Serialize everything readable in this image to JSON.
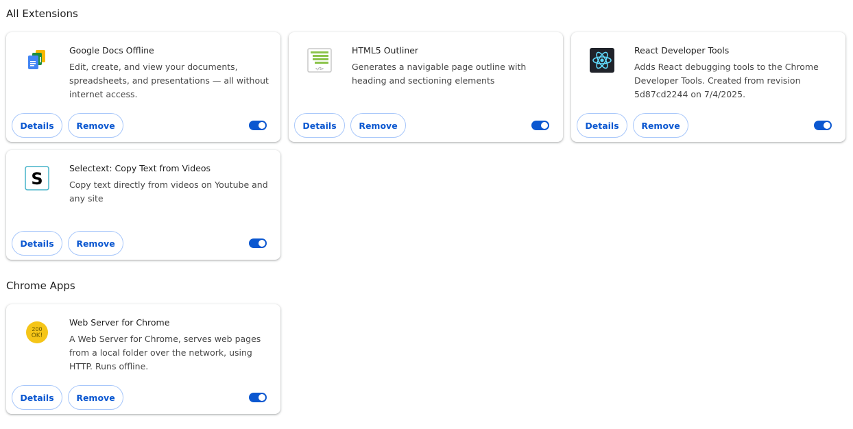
{
  "sections": {
    "extensions_title": "All Extensions",
    "apps_title": "Chrome Apps"
  },
  "extensions": [
    {
      "name": "Google Docs Offline",
      "description": "Edit, create, and view your documents, spreadsheets, and presentations — all without internet access.",
      "details_label": "Details",
      "remove_label": "Remove",
      "enabled": true,
      "icon": "google-docs-offline-icon"
    },
    {
      "name": "HTML5 Outliner",
      "description": "Generates a navigable page outline with heading and sectioning elements",
      "details_label": "Details",
      "remove_label": "Remove",
      "enabled": true,
      "icon": "html5-outliner-icon",
      "icon_text": "</5>"
    },
    {
      "name": "React Developer Tools",
      "description": "Adds React debugging tools to the Chrome Developer Tools. Created from revision 5d87cd2244 on 7/4/2025.",
      "details_label": "Details",
      "remove_label": "Remove",
      "enabled": true,
      "icon": "react-icon"
    },
    {
      "name": "Selectext: Copy Text from Videos",
      "description": "Copy text directly from videos on Youtube and any site",
      "details_label": "Details",
      "remove_label": "Remove",
      "enabled": true,
      "icon": "selectext-icon",
      "icon_text": "S"
    }
  ],
  "apps": [
    {
      "name": "Web Server for Chrome",
      "description": "A Web Server for Chrome, serves web pages from a local folder over the network, using HTTP. Runs offline.",
      "details_label": "Details",
      "remove_label": "Remove",
      "enabled": true,
      "icon": "web-server-icon",
      "icon_text_top": "200",
      "icon_text_bottom": "OK!"
    }
  ],
  "colors": {
    "accent": "#0b57d0",
    "button_border": "#a8c7fa",
    "text_primary": "#1f1f1f",
    "text_secondary": "#474747"
  }
}
